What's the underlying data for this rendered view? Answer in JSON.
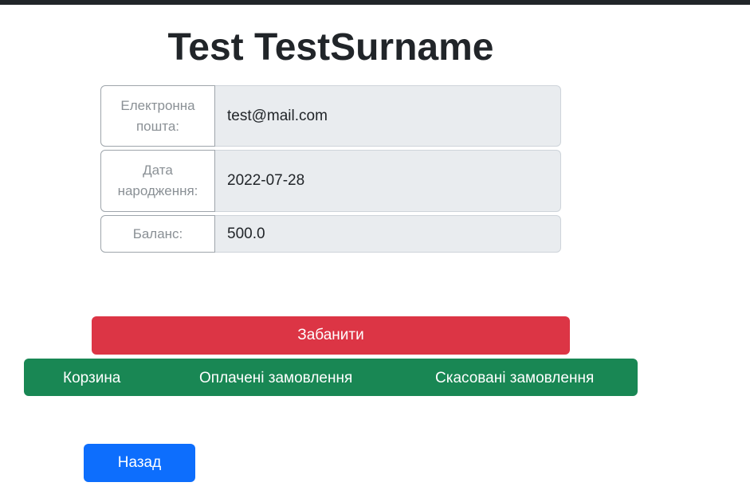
{
  "user": {
    "full_name": "Test TestSurname"
  },
  "profile_fields": {
    "email": {
      "label": "Електронна пошта:",
      "value": "test@mail.com"
    },
    "birth_date": {
      "label": "Дата народження:",
      "value": "2022-07-28"
    },
    "balance": {
      "label": "Баланс:",
      "value": "500.0"
    }
  },
  "actions": {
    "ban_label": "Забанити",
    "back_label": "Назад"
  },
  "orders_nav": {
    "cart_label": "Корзина",
    "paid_label": "Оплачені замовлення",
    "cancelled_label": "Скасовані замовлення"
  },
  "colors": {
    "danger": "#dc3545",
    "success": "#198754",
    "primary": "#0d6efd",
    "top_bar": "#212529"
  }
}
